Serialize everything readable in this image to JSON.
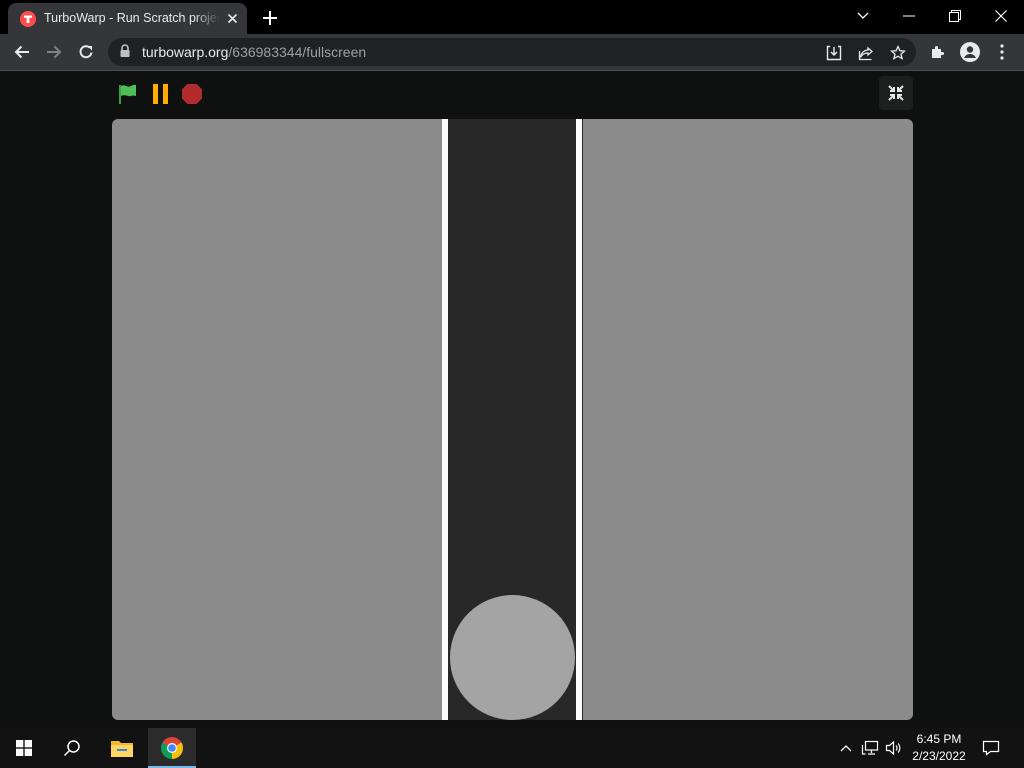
{
  "browser": {
    "tab": {
      "title": "TurboWarp - Run Scratch projects",
      "favicon": "turbowarp-logo-icon"
    },
    "address_bar": {
      "host": "turbowarp.org",
      "path": "/636983344/fullscreen"
    },
    "window_controls": [
      "chevron-down-icon",
      "minimize-icon",
      "restore-icon",
      "close-icon"
    ],
    "toolbar_icons": [
      "back-arrow-icon",
      "forward-arrow-icon",
      "reload-icon",
      "install-icon",
      "share-icon",
      "bookmark-star-icon",
      "extensions-puzzle-icon",
      "profile-icon",
      "menu-dots-icon"
    ]
  },
  "player": {
    "controls": [
      "green-flag-icon",
      "pause-icon",
      "stop-icon"
    ],
    "exit_fullscreen": "exit-fullscreen-icon",
    "colors": {
      "stage": "#8c8c8c",
      "lane": "#282828",
      "lane_lines": "#ffffff",
      "ball": "#a4a4a4",
      "flag": "#4cbf56",
      "pause": "#ffae00",
      "stop": "#b22b2b"
    }
  },
  "taskbar": {
    "icons": [
      "windows-start-icon",
      "search-icon",
      "file-explorer-icon",
      "chrome-icon"
    ],
    "tray_icons": [
      "show-hidden-icons-chevron",
      "network-icon",
      "volume-icon",
      "notifications-icon"
    ],
    "clock": {
      "time": "6:45 PM",
      "date": "2/23/2022"
    }
  }
}
